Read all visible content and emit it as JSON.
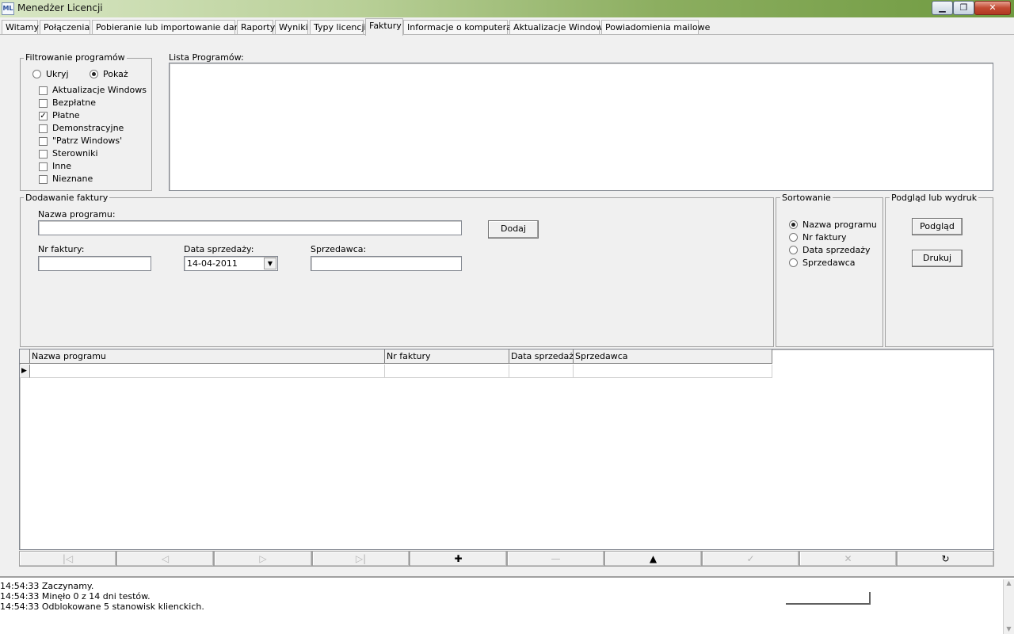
{
  "window": {
    "title": "Menedżer Licencji",
    "icon_text": "ML"
  },
  "tabs": [
    "Witamy",
    "Połączenia",
    "Pobieranie lub importowanie danych",
    "Raporty",
    "Wyniki",
    "Typy licencji",
    "Faktury",
    "Informacje o komputerach",
    "Aktualizacje Windows",
    "Powiadomienia mailowe"
  ],
  "active_tab": "Faktury",
  "filter": {
    "legend": "Filtrowanie programów",
    "hide_label": "Ukryj",
    "show_label": "Pokaż",
    "selected": "Pokaż",
    "items": [
      {
        "label": "Aktualizacje Windows",
        "checked": false
      },
      {
        "label": "Bezpłatne",
        "checked": false
      },
      {
        "label": "Płatne",
        "checked": true
      },
      {
        "label": "Demonstracyjne",
        "checked": false
      },
      {
        "label": "\"Patrz Windows'",
        "checked": false
      },
      {
        "label": "Sterowniki",
        "checked": false
      },
      {
        "label": "Inne",
        "checked": false
      },
      {
        "label": "Nieznane",
        "checked": false
      }
    ]
  },
  "program_list": {
    "label": "Lista Programów:"
  },
  "add_invoice": {
    "legend": "Dodawanie faktury",
    "program_name_label": "Nazwa programu:",
    "program_name_value": "",
    "add_button": "Dodaj",
    "invoice_no_label": "Nr faktury:",
    "invoice_no_value": "",
    "sale_date_label": "Data sprzedaży:",
    "sale_date_value": "14-04-2011",
    "seller_label": "Sprzedawca:",
    "seller_value": ""
  },
  "sorting": {
    "legend": "Sortowanie",
    "options": [
      "Nazwa programu",
      "Nr faktury",
      "Data sprzedaży",
      "Sprzedawca"
    ],
    "selected": "Nazwa programu"
  },
  "preview": {
    "legend": "Podgląd lub wydruk",
    "preview_button": "Podgląd",
    "print_button": "Drukuj"
  },
  "grid": {
    "columns": [
      "Nazwa programu",
      "Nr faktury",
      "Data sprzedaży",
      "Sprzedawca"
    ],
    "rows": [
      [
        "",
        "",
        "",
        ""
      ]
    ]
  },
  "navigator": [
    {
      "name": "first",
      "glyph": "|◁",
      "enabled": false
    },
    {
      "name": "prior",
      "glyph": "◁",
      "enabled": false
    },
    {
      "name": "next",
      "glyph": "▷",
      "enabled": false
    },
    {
      "name": "last",
      "glyph": "▷|",
      "enabled": false
    },
    {
      "name": "insert",
      "glyph": "✚",
      "enabled": true
    },
    {
      "name": "delete",
      "glyph": "—",
      "enabled": false
    },
    {
      "name": "edit",
      "glyph": "▲",
      "enabled": true
    },
    {
      "name": "post",
      "glyph": "✓",
      "enabled": false
    },
    {
      "name": "cancel",
      "glyph": "✕",
      "enabled": false
    },
    {
      "name": "refresh",
      "glyph": "↻",
      "enabled": true
    }
  ],
  "log": [
    "14:54:33  Zaczynamy.",
    "14:54:33  Minęło 0 z 14 dni testów.",
    "14:54:33  Odblokowane 5 stanowisk klienckich."
  ]
}
